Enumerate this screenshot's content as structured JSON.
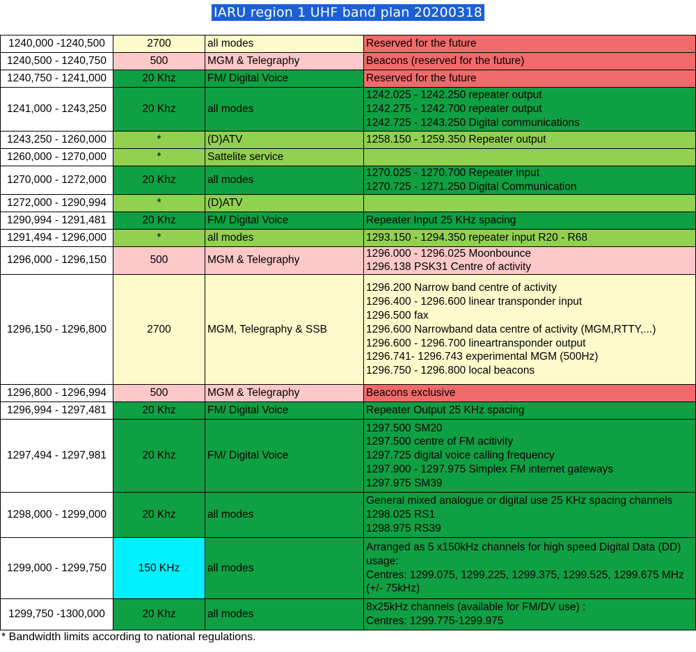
{
  "title": "IARU region 1 UHF band plan 20200318",
  "colors": {
    "light_yellow": "#fffacc",
    "pink": "#fcc8c8",
    "dark_green": "#0fa044",
    "light_green": "#92d050",
    "red": "#f26a6a",
    "cyan": "#00f0ff",
    "white": "#ffffff"
  },
  "rows": [
    {
      "range": "1240,000 -1240,500",
      "bandwidth": "2700",
      "mode": "all modes",
      "usage": [
        "Reserved for the future"
      ],
      "bg": [
        "white",
        "light_yellow",
        "light_yellow",
        "red"
      ]
    },
    {
      "range": "1240,500 - 1240,750",
      "bandwidth": "500",
      "mode": "MGM & Telegraphy",
      "usage": [
        "Beacons (reserved for the future)"
      ],
      "bg": [
        "white",
        "pink",
        "pink",
        "red"
      ]
    },
    {
      "range": "1240,750 - 1241,000",
      "bandwidth": "20 Khz",
      "mode": "FM/ Digital Voice",
      "usage": [
        "Reserved for the future"
      ],
      "bg": [
        "white",
        "dark_green",
        "dark_green",
        "red"
      ]
    },
    {
      "range": "1241,000 - 1243,250",
      "bandwidth": "20 Khz",
      "mode": "all modes",
      "usage": [
        "1242.025 - 1242.250 repeater output",
        "1242.275 - 1242.700 repeater output",
        "1242.725 - 1243.250 Digital communications"
      ],
      "bg": [
        "white",
        "dark_green",
        "dark_green",
        "dark_green"
      ]
    },
    {
      "range": "1243,250 - 1260,000",
      "bandwidth": "*",
      "mode": "(D)ATV",
      "usage": [
        "1258.150 - 1259.350 Repeater output"
      ],
      "bg": [
        "white",
        "light_green",
        "light_green",
        "light_green"
      ]
    },
    {
      "range": "1260,000 - 1270,000",
      "bandwidth": "*",
      "mode": "Sattelite service",
      "usage": [
        ""
      ],
      "bg": [
        "white",
        "light_green",
        "light_green",
        "light_green"
      ]
    },
    {
      "range": "1270,000 - 1272,000",
      "bandwidth": "20 Khz",
      "mode": "all modes",
      "usage": [
        "1270.025 - 1270.700  Repeater input",
        "1270.725 - 1271.250  Digital Communication"
      ],
      "bg": [
        "white",
        "dark_green",
        "dark_green",
        "dark_green"
      ]
    },
    {
      "range": "1272,000 - 1290,994",
      "bandwidth": "*",
      "mode": "(D)ATV",
      "usage": [
        ""
      ],
      "bg": [
        "white",
        "light_green",
        "light_green",
        "light_green"
      ]
    },
    {
      "range": "1290,994 - 1291,481",
      "bandwidth": "20 Khz",
      "mode": "FM/ Digital Voice",
      "usage": [
        "Repeater Input 25 KHz spacing"
      ],
      "bg": [
        "white",
        "dark_green",
        "dark_green",
        "dark_green"
      ]
    },
    {
      "range": "1291,494 - 1296,000",
      "bandwidth": "*",
      "mode": "all modes",
      "usage": [
        "1293.150 - 1294.350 repeater input R20 - R68"
      ],
      "bg": [
        "white",
        "light_green",
        "light_green",
        "light_green"
      ]
    },
    {
      "range": "1296,000 - 1296,150",
      "bandwidth": "500",
      "mode": "MGM & Telegraphy",
      "usage": [
        "1296.000 - 1296.025  Moonbounce",
        "1296.138  PSK31 Centre of activity"
      ],
      "bg": [
        "white",
        "pink",
        "pink",
        "pink"
      ]
    },
    {
      "range": "1296,150 - 1296,800",
      "bandwidth": "2700",
      "mode": "MGM, Telegraphy & SSB",
      "usage": [
        "1296.200 Narrow band centre of activity",
        "1296.400 - 1296.600 linear transponder input",
        "1296.500  fax",
        "1296.600  Narrowband data centre of activity (MGM,RTTY,...)",
        "1296.600 - 1296.700 lineartransponder output",
        "1296.741- 1296.743  experimental MGM (500Hz)",
        "1296.750 - 1296.800 local beacons"
      ],
      "bg": [
        "white",
        "light_yellow",
        "light_yellow",
        "light_yellow"
      ]
    },
    {
      "range": "1296,800 - 1296,994",
      "bandwidth": "500",
      "mode": "MGM & Telegraphy",
      "usage": [
        "Beacons exclusive"
      ],
      "bg": [
        "white",
        "pink",
        "pink",
        "red"
      ]
    },
    {
      "range": "1296,994 - 1297,481",
      "bandwidth": "20 Khz",
      "mode": "FM/ Digital Voice",
      "usage": [
        "Repeater Output 25 KHz spacing"
      ],
      "bg": [
        "white",
        "dark_green",
        "dark_green",
        "dark_green"
      ]
    },
    {
      "range": "1297,494 - 1297,981",
      "bandwidth": "20 Khz",
      "mode": "FM/ Digital Voice",
      "usage": [
        "1297.500 SM20",
        "1297.500 centre of FM acitivity",
        "1297.725 digital voice calling frequency",
        "1297.900 - 1297.975 Simplex FM internet gateways",
        "1297.975  SM39"
      ],
      "bg": [
        "white",
        "dark_green",
        "dark_green",
        "dark_green"
      ]
    },
    {
      "range": "1298,000 - 1299,000",
      "bandwidth": "20 Khz",
      "mode": "all modes",
      "usage": [
        "General mixed analogue or digital use 25 KHz spacing channels",
        "1298.025 RS1",
        "1298.975 RS39"
      ],
      "bg": [
        "white",
        "dark_green",
        "dark_green",
        "dark_green"
      ]
    },
    {
      "range": "1299,000 - 1299,750",
      "bandwidth": "150 KHz",
      "mode": "all modes",
      "usage": [
        "Arranged as 5 x150kHz channels for high speed Digital Data (DD)",
        "usage:",
        "Centres: 1299.075, 1299.225, 1299.375, 1299.525, 1299.675 MHz",
        "(+/- 75kHz)"
      ],
      "bg": [
        "white",
        "cyan",
        "dark_green",
        "dark_green"
      ]
    },
    {
      "range": "1299,750 -1300,000",
      "bandwidth": "20 Khz",
      "mode": "all modes",
      "usage": [
        "8x25kHz channels (available for FM/DV use) :",
        "Centres: 1299.775-1299.975"
      ],
      "bg": [
        "white",
        "dark_green",
        "dark_green",
        "dark_green"
      ]
    }
  ],
  "footnote": "* Bandwidth limits according to national regulations."
}
